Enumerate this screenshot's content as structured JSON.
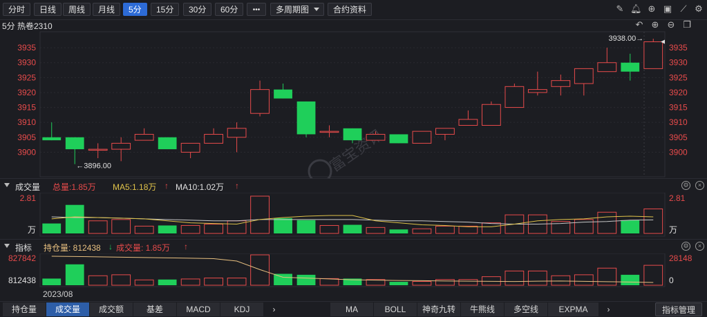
{
  "toolbar": {
    "periods": [
      "分时",
      "日线",
      "周线",
      "月线",
      "5分",
      "15分",
      "30分",
      "60分"
    ],
    "active_period": "5分",
    "more_label": "•••",
    "multi_period_label": "多周期图",
    "contract_info_label": "合约资料",
    "icons": [
      "pen-icon",
      "bell-icon",
      "crosshair-icon",
      "camera-icon",
      "ruler-icon",
      "gear-icon"
    ]
  },
  "main_title": "5分 热卷2310",
  "title_icons": [
    "undo-icon",
    "plus-icon",
    "minus-icon",
    "window-icon"
  ],
  "volume_header": {
    "name": "成交量",
    "total": "总量:1.85万",
    "ma5": "MA5:1.18万",
    "ma10": "MA10:1.02万"
  },
  "indicator_header": {
    "name": "指标",
    "oi": "持仓量: 812438",
    "vol": "成交量: 1.85万"
  },
  "watermark": "富宝资讯",
  "date_label": "2023/08",
  "colors": {
    "up": "#e84b4b",
    "down": "#1fcf5a",
    "bg": "#1c1d22",
    "ma5": "#e0c34a",
    "ma10": "#c8c8c8",
    "oi_line": "#e8c080"
  },
  "bottom_left_tabs": [
    "持仓量",
    "成交量",
    "成交额",
    "基差",
    "MACD",
    "KDJ"
  ],
  "bottom_left_active": "成交量",
  "bottom_right_tabs": [
    "MA",
    "BOLL",
    "神奇九转",
    "牛熊线",
    "多空线",
    "EXPMA"
  ],
  "indicator_manage_label": "指标管理",
  "arrow_label": "›",
  "chart_data": [
    {
      "type": "candlestick",
      "title": "5分 热卷2310",
      "y_ticks": [
        3900,
        3905,
        3910,
        3915,
        3920,
        3925,
        3930,
        3935
      ],
      "ylim": [
        3896,
        3938
      ],
      "annotations": {
        "high": "3938.00",
        "low": "3896.00"
      },
      "candles": [
        {
          "o": 3905,
          "c": 3904,
          "h": 3910,
          "l": 3904
        },
        {
          "o": 3905,
          "c": 3901,
          "h": 3905,
          "l": 3896
        },
        {
          "o": 3901,
          "c": 3901,
          "h": 3903,
          "l": 3898
        },
        {
          "o": 3901,
          "c": 3903,
          "h": 3905,
          "l": 3897
        },
        {
          "o": 3904,
          "c": 3906,
          "h": 3908,
          "l": 3904
        },
        {
          "o": 3905,
          "c": 3901,
          "h": 3905,
          "l": 3901
        },
        {
          "o": 3900,
          "c": 3903,
          "h": 3903,
          "l": 3898
        },
        {
          "o": 3903,
          "c": 3906,
          "h": 3908,
          "l": 3903
        },
        {
          "o": 3905,
          "c": 3908,
          "h": 3910,
          "l": 3900
        },
        {
          "o": 3913,
          "c": 3921,
          "h": 3924,
          "l": 3912
        },
        {
          "o": 3921,
          "c": 3918,
          "h": 3923,
          "l": 3918
        },
        {
          "o": 3917,
          "c": 3906,
          "h": 3917,
          "l": 3905
        },
        {
          "o": 3907,
          "c": 3907,
          "h": 3909,
          "l": 3905
        },
        {
          "o": 3908,
          "c": 3904,
          "h": 3908,
          "l": 3903
        },
        {
          "o": 3904,
          "c": 3906,
          "h": 3907,
          "l": 3904
        },
        {
          "o": 3906,
          "c": 3903,
          "h": 3906,
          "l": 3903
        },
        {
          "o": 3903,
          "c": 3907,
          "h": 3907,
          "l": 3903
        },
        {
          "o": 3906,
          "c": 3908,
          "h": 3908,
          "l": 3904
        },
        {
          "o": 3909,
          "c": 3911,
          "h": 3914,
          "l": 3909
        },
        {
          "o": 3909,
          "c": 3916,
          "h": 3917,
          "l": 3909
        },
        {
          "o": 3915,
          "c": 3922,
          "h": 3923,
          "l": 3915
        },
        {
          "o": 3920,
          "c": 3921,
          "h": 3927,
          "l": 3919
        },
        {
          "o": 3922,
          "c": 3924,
          "h": 3926,
          "l": 3919
        },
        {
          "o": 3923,
          "c": 3928,
          "h": 3928,
          "l": 3919
        },
        {
          "o": 3927,
          "c": 3930,
          "h": 3935,
          "l": 3927
        },
        {
          "o": 3930,
          "c": 3927,
          "h": 3933,
          "l": 3924
        },
        {
          "o": 3928,
          "c": 3937,
          "h": 3938,
          "l": 3928
        }
      ]
    },
    {
      "type": "bar",
      "title": "成交量",
      "y_ticks_left": [
        "2.81",
        "万"
      ],
      "y_ticks_right": [
        "2.81",
        "万"
      ],
      "ymax": 2.81,
      "values": [
        0.75,
        2.15,
        0.95,
        1.05,
        0.55,
        0.6,
        0.6,
        0.7,
        0.95,
        2.81,
        1.15,
        1.0,
        0.6,
        0.65,
        0.45,
        0.3,
        0.35,
        0.55,
        0.55,
        0.8,
        1.4,
        1.4,
        0.9,
        1.05,
        1.6,
        1.0,
        1.85
      ],
      "ma5": [
        1.1,
        1.25,
        1.2,
        1.15,
        1.1,
        0.95,
        0.8,
        0.75,
        0.7,
        1.05,
        1.2,
        1.3,
        1.35,
        1.35,
        0.95,
        0.8,
        0.65,
        0.6,
        0.5,
        0.5,
        0.7,
        0.95,
        1.05,
        1.1,
        1.25,
        1.3,
        1.25
      ],
      "ma10": [
        1.25,
        1.2,
        1.2,
        1.15,
        1.1,
        1.05,
        1.0,
        0.95,
        0.95,
        1.05,
        1.05,
        1.05,
        1.05,
        1.05,
        1.0,
        0.95,
        0.95,
        0.9,
        0.85,
        0.75,
        0.7,
        0.7,
        0.75,
        0.85,
        0.9,
        1.0,
        1.02
      ]
    },
    {
      "type": "bar",
      "title": "指标",
      "y_ticks_left": [
        "827842",
        "812438"
      ],
      "y_ticks_right": [
        "28148",
        "0"
      ],
      "x_label": "2023/08",
      "volume_values": [
        0.35,
        1.1,
        0.5,
        0.55,
        0.28,
        0.3,
        0.33,
        0.38,
        0.38,
        1.6,
        0.6,
        0.55,
        0.35,
        0.35,
        0.3,
        0.18,
        0.2,
        0.3,
        0.3,
        0.45,
        0.75,
        0.75,
        0.5,
        0.55,
        0.9,
        0.55,
        1.05
      ],
      "open_interest": [
        827842,
        827700,
        827500,
        827300,
        827100,
        826900,
        826700,
        826400,
        825000,
        820000,
        815500,
        815000,
        814500,
        814000,
        813800,
        813600,
        813500,
        813300,
        813200,
        813100,
        813000,
        813200,
        813300,
        813100,
        812900,
        812700,
        812438
      ]
    }
  ]
}
